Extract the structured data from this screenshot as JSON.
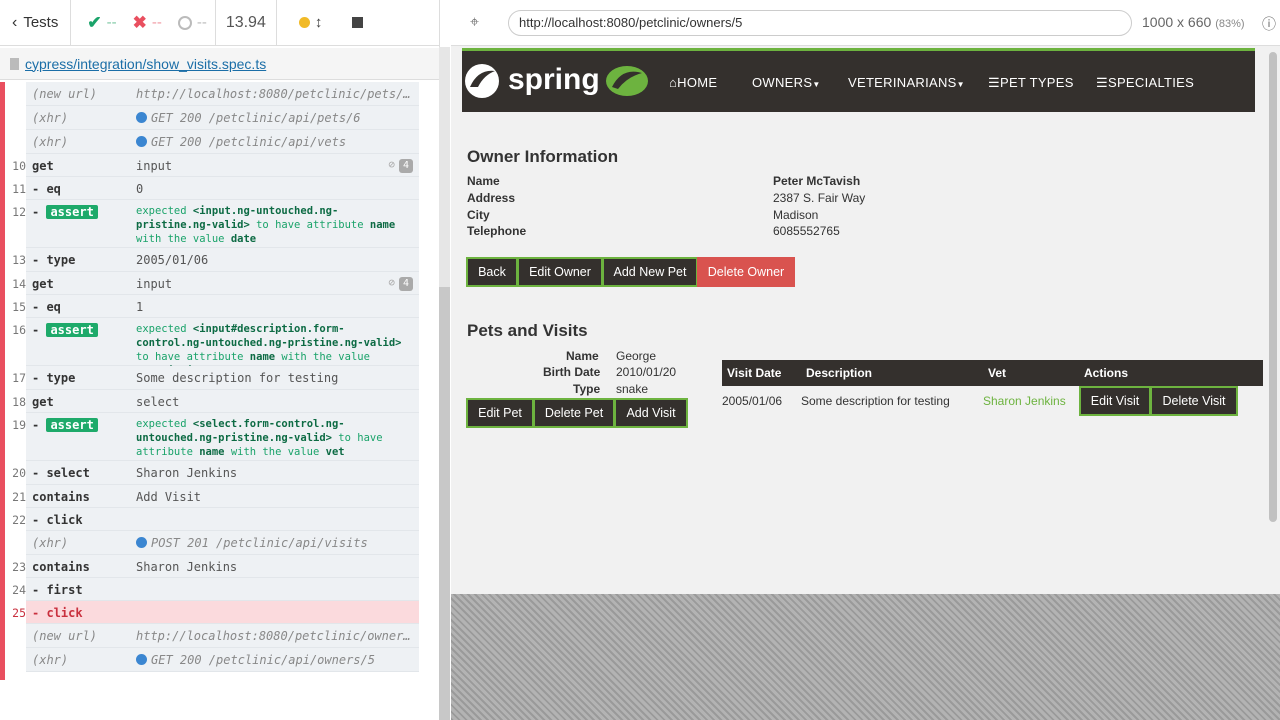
{
  "runner": {
    "tests_label": "Tests",
    "passed": "--",
    "failed": "--",
    "pending": "--",
    "duration": "13.94",
    "spec_file": "cypress/integration/show_visits.spec.ts",
    "url": "http://localhost:8080/petclinic/owners/5",
    "viewport": "1000 x 660",
    "viewport_scale": "(83%)"
  },
  "commands": [
    {
      "num": "",
      "name": "(new url)",
      "msg": "http://localhost:8080/petclinic/pets/…",
      "kind": "event"
    },
    {
      "num": "",
      "name": "(xhr)",
      "msg": "GET 200 /petclinic/api/pets/6",
      "kind": "xhr"
    },
    {
      "num": "",
      "name": "(xhr)",
      "msg": "GET 200 /petclinic/api/vets",
      "kind": "xhr"
    },
    {
      "num": "10",
      "name": "get",
      "msg": "input",
      "kind": "get",
      "count": "4"
    },
    {
      "num": "11",
      "name": "-eq",
      "msg": "0",
      "kind": "child"
    },
    {
      "num": "12",
      "name": "-assert",
      "msg_parts": [
        "expected",
        "<input.ng-untouched.ng-pristine.ng-valid>",
        "to have attribute",
        "name",
        "with the value",
        "date"
      ],
      "kind": "assert"
    },
    {
      "num": "13",
      "name": "-type",
      "msg": "2005/01/06",
      "kind": "child"
    },
    {
      "num": "14",
      "name": "get",
      "msg": "input",
      "kind": "get",
      "count": "4"
    },
    {
      "num": "15",
      "name": "-eq",
      "msg": "1",
      "kind": "child"
    },
    {
      "num": "16",
      "name": "-assert",
      "msg_parts": [
        "expected",
        "<input#description.form-control.ng-untouched.ng-pristine.ng-valid>",
        "to have attribute",
        "name",
        "with the value",
        "description"
      ],
      "kind": "assert"
    },
    {
      "num": "17",
      "name": "-type",
      "msg": "Some description for testing",
      "kind": "child"
    },
    {
      "num": "18",
      "name": "get",
      "msg": "select",
      "kind": "get"
    },
    {
      "num": "19",
      "name": "-assert",
      "msg_parts": [
        "expected",
        "<select.form-control.ng-untouched.ng-pristine.ng-valid>",
        "to have attribute",
        "name",
        "with the value",
        "vet"
      ],
      "kind": "assert"
    },
    {
      "num": "20",
      "name": "-select",
      "msg": "Sharon Jenkins",
      "kind": "child"
    },
    {
      "num": "21",
      "name": "contains",
      "msg": "Add Visit",
      "kind": "get"
    },
    {
      "num": "22",
      "name": "-click",
      "msg": "",
      "kind": "child"
    },
    {
      "num": "",
      "name": "(xhr)",
      "msg": "POST 201 /petclinic/api/visits",
      "kind": "xhr"
    },
    {
      "num": "23",
      "name": "contains",
      "msg": "Sharon Jenkins",
      "kind": "get"
    },
    {
      "num": "24",
      "name": "-first",
      "msg": "",
      "kind": "child"
    },
    {
      "num": "25",
      "name": "-click",
      "msg": "",
      "kind": "fail"
    },
    {
      "num": "",
      "name": "(new url)",
      "msg": "http://localhost:8080/petclinic/owner…",
      "kind": "event"
    },
    {
      "num": "",
      "name": "(xhr)",
      "msg": "GET 200 /petclinic/api/owners/5",
      "kind": "xhr"
    }
  ],
  "app": {
    "logo_text": "spring",
    "nav": [
      "HOME",
      "OWNERS",
      "VETERINARIANS",
      "PET TYPES",
      "SPECIALTIES"
    ],
    "owner_heading": "Owner Information",
    "owner_labels": [
      "Name",
      "Address",
      "City",
      "Telephone"
    ],
    "owner_values": [
      "Peter McTavish",
      "2387 S. Fair Way",
      "Madison",
      "6085552765"
    ],
    "owner_buttons": [
      "Back",
      "Edit Owner",
      "Add New Pet",
      "Delete Owner"
    ],
    "pets_heading": "Pets and Visits",
    "pet_labels": [
      "Name",
      "Birth Date",
      "Type"
    ],
    "pet_values": [
      "George",
      "2010/01/20",
      "snake"
    ],
    "pet_buttons": [
      "Edit Pet",
      "Delete Pet",
      "Add Visit"
    ],
    "visit_columns": [
      "Visit Date",
      "Description",
      "Vet",
      "Actions"
    ],
    "visit_row": {
      "date": "2005/01/06",
      "description": "Some description for testing",
      "vet": "Sharon Jenkins"
    },
    "visit_buttons": [
      "Edit Visit",
      "Delete Visit"
    ]
  },
  "colors": {
    "accent": "#6db33f",
    "dark": "#34302d",
    "danger": "#d9534f",
    "fail": "#e94f5f"
  }
}
